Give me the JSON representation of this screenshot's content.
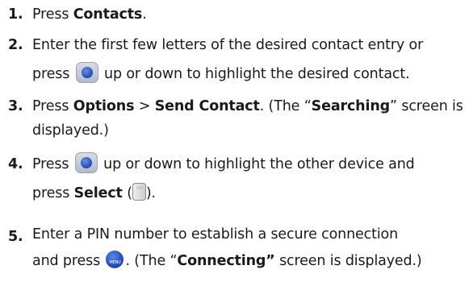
{
  "steps": [
    {
      "number": "1.",
      "lines": {
        "pre": "Press ",
        "b1": "Contacts",
        "post": "."
      }
    },
    {
      "number": "2.",
      "l1": "Enter the first few letters of the desired contact entry or",
      "l2_pre": "press ",
      "l2_post": " up or down to highlight the desired contact."
    },
    {
      "number": "3.",
      "pre": "Press ",
      "b1": "Options",
      "mid": " > ",
      "b2": "Send Contact",
      "mid2": ". (The “",
      "b3": "Searching",
      "post": "” screen is",
      "l2": "displayed.)"
    },
    {
      "number": "4.",
      "l1_pre": "Press ",
      "l1_post": " up or down to highlight the other device and",
      "l2_pre": "press ",
      "b1": "Select",
      "l2_mid": " (",
      "l2_post": ")."
    },
    {
      "number": "5.",
      "l1": "Enter a PIN number to establish a secure connection",
      "l2_pre": "and press ",
      "l2_mid": ". (The “",
      "b1": "Connecting”",
      "l2_post": " screen is displayed.)"
    }
  ],
  "icons": {
    "menu_key_top": "MENU",
    "menu_key_bottom": "OK"
  }
}
